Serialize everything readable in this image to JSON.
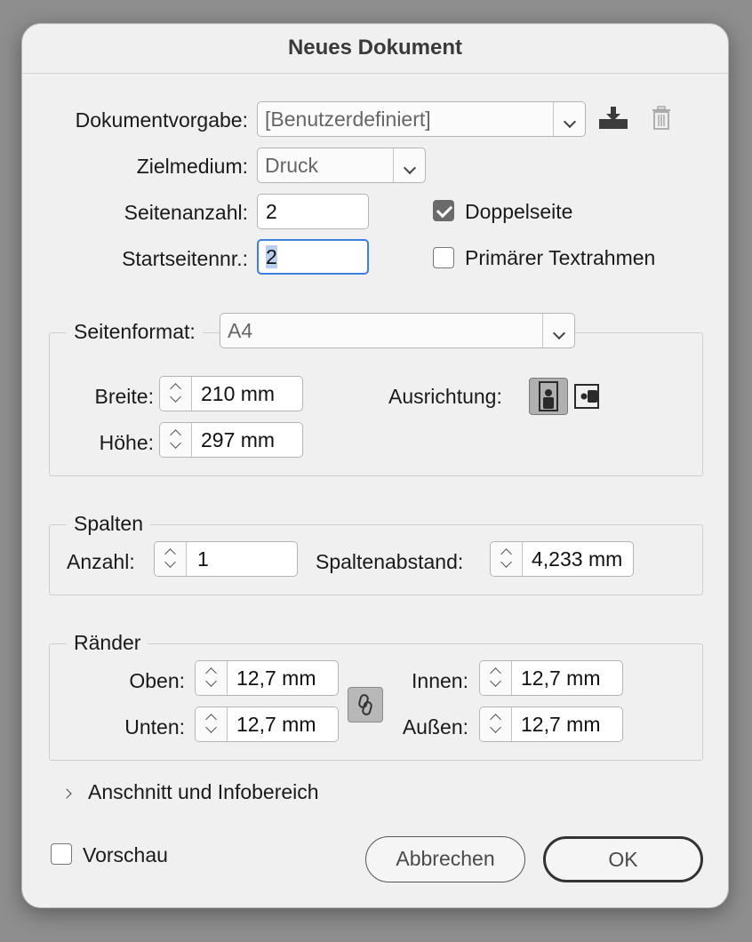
{
  "dialog": {
    "title": "Neues Dokument"
  },
  "top": {
    "preset_label": "Dokumentvorgabe:",
    "preset_value": "[Benutzerdefiniert]",
    "intent_label": "Zielmedium:",
    "intent_value": "Druck",
    "pages_label": "Seitenanzahl:",
    "pages_value": "2",
    "start_label": "Startseitennr.:",
    "start_value": "2",
    "facing_label": "Doppelseite",
    "facing_checked": true,
    "primary_frame_label": "Primärer Textrahmen",
    "primary_frame_checked": false
  },
  "page_size": {
    "legend": "Seitenformat:",
    "value": "A4",
    "width_label": "Breite:",
    "width_value": "210 mm",
    "height_label": "Höhe:",
    "height_value": "297 mm",
    "orientation_label": "Ausrichtung:"
  },
  "columns": {
    "legend": "Spalten",
    "count_label": "Anzahl:",
    "count_value": "1",
    "gutter_label": "Spaltenabstand:",
    "gutter_value": "4,233 mm"
  },
  "margins": {
    "legend": "Ränder",
    "top_label": "Oben:",
    "top_value": "12,7 mm",
    "bottom_label": "Unten:",
    "bottom_value": "12,7 mm",
    "inside_label": "Innen:",
    "inside_value": "12,7 mm",
    "outside_label": "Außen:",
    "outside_value": "12,7 mm"
  },
  "bleed": {
    "label": "Anschnitt und Infobereich"
  },
  "footer": {
    "preview_label": "Vorschau",
    "cancel_label": "Abbrechen",
    "ok_label": "OK"
  }
}
